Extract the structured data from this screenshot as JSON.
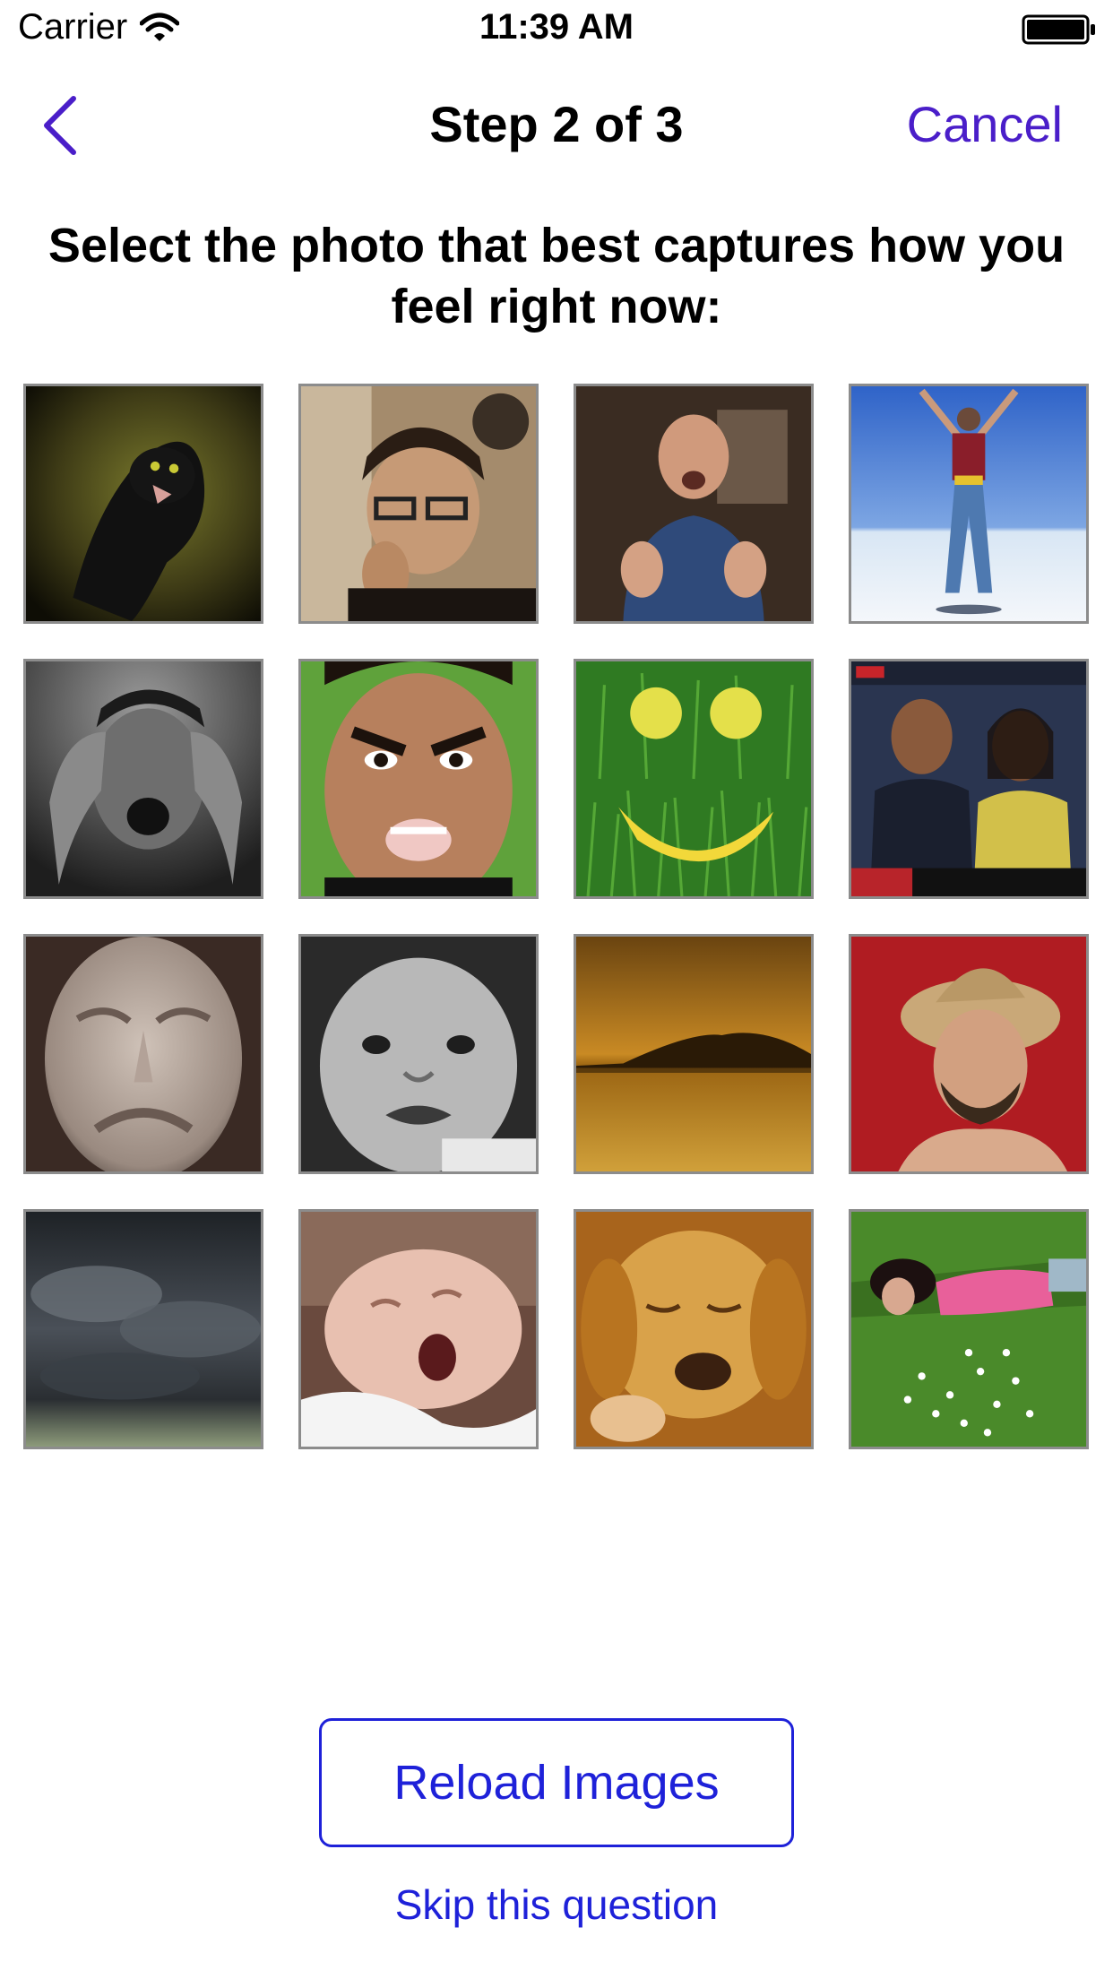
{
  "status_bar": {
    "carrier": "Carrier",
    "time": "11:39 AM",
    "icons": [
      "wifi-icon",
      "battery-icon"
    ]
  },
  "nav": {
    "back_icon": "chevron-left-icon",
    "title": "Step 2 of 3",
    "cancel_label": "Cancel"
  },
  "question": "Select the photo that best captures how you feel right now:",
  "photos": [
    {
      "name": "photo-black-cat-hissing"
    },
    {
      "name": "photo-nervous-woman-glasses"
    },
    {
      "name": "photo-man-thumbs-up"
    },
    {
      "name": "photo-woman-jumping-salt-flats"
    },
    {
      "name": "photo-man-screaming-holding-head"
    },
    {
      "name": "photo-man-angry-face"
    },
    {
      "name": "photo-fruit-smiley-face-grass"
    },
    {
      "name": "photo-couple-news-broadcast"
    },
    {
      "name": "photo-sad-sculpture-face"
    },
    {
      "name": "photo-crying-baby"
    },
    {
      "name": "photo-sunset-lake"
    },
    {
      "name": "photo-man-cowboy-hat"
    },
    {
      "name": "photo-storm-clouds"
    },
    {
      "name": "photo-baby-yawning"
    },
    {
      "name": "photo-sleeping-dog"
    },
    {
      "name": "photo-woman-lying-in-grass"
    }
  ],
  "reload_label": "Reload Images",
  "skip_label": "Skip this question",
  "colors": {
    "accent_purple": "#4a1ec9",
    "accent_blue": "#1e21d9",
    "tile_border": "#8c8c8c"
  }
}
